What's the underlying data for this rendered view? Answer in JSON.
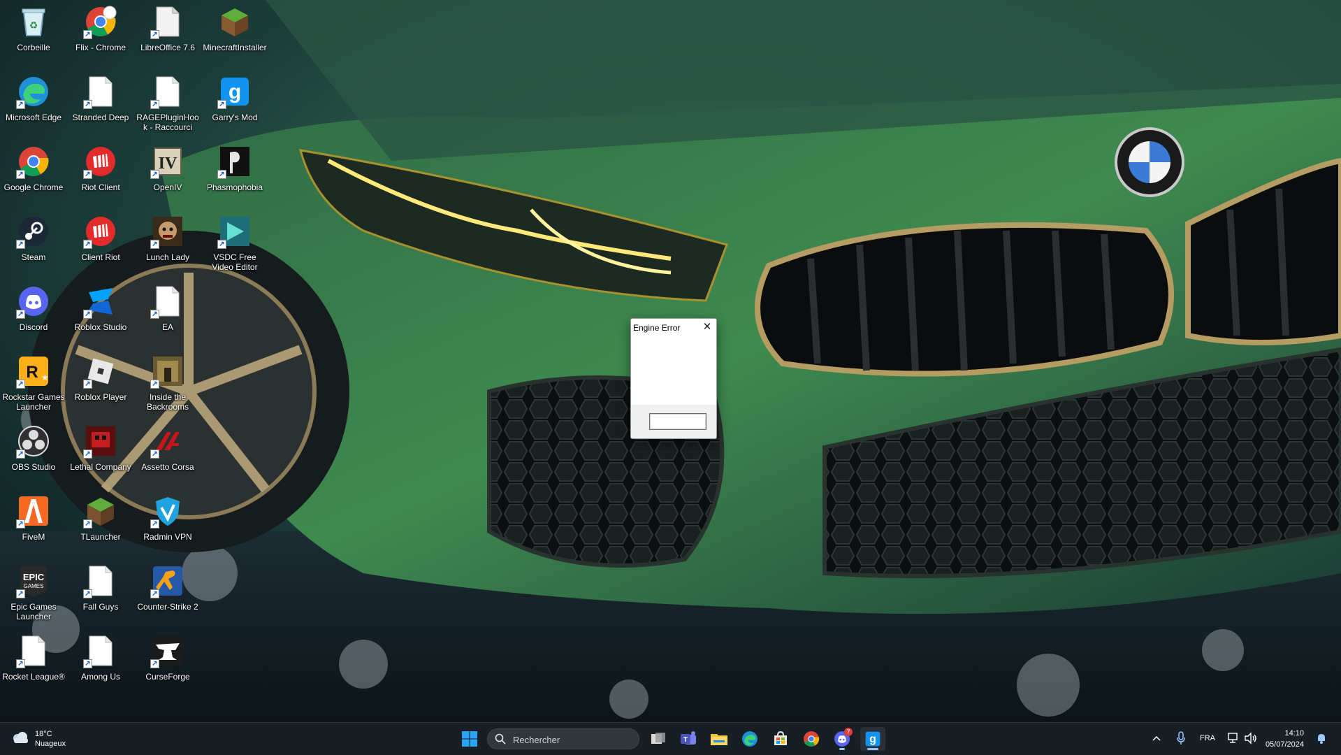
{
  "desktop": {
    "icons": [
      {
        "label": "Corbeille",
        "icon": "recycle-bin-icon"
      },
      {
        "label": "Flix - Chrome",
        "icon": "chrome-icon"
      },
      {
        "label": "LibreOffice 7.6",
        "icon": "file-icon"
      },
      {
        "label": "MinecraftInstaller",
        "icon": "minecraft-icon"
      },
      {
        "label": "Microsoft Edge",
        "icon": "edge-icon"
      },
      {
        "label": "Stranded Deep",
        "icon": "file-icon"
      },
      {
        "label": "RAGEPluginHook - Raccourci",
        "icon": "file-icon"
      },
      {
        "label": "Garry's Mod",
        "icon": "garrys-mod-icon"
      },
      {
        "label": "Google Chrome",
        "icon": "chrome-icon"
      },
      {
        "label": "Riot Client",
        "icon": "riot-icon"
      },
      {
        "label": "OpenIV",
        "icon": "openiv-icon"
      },
      {
        "label": "Phasmophobia",
        "icon": "phasmophobia-icon"
      },
      {
        "label": "Steam",
        "icon": "steam-icon"
      },
      {
        "label": "Client Riot",
        "icon": "riot-icon"
      },
      {
        "label": "Lunch Lady",
        "icon": "lunch-lady-icon"
      },
      {
        "label": "VSDC Free Video Editor",
        "icon": "vsdc-icon"
      },
      {
        "label": "Discord",
        "icon": "discord-icon"
      },
      {
        "label": "Roblox Studio",
        "icon": "roblox-studio-icon"
      },
      {
        "label": "EA",
        "icon": "file-icon"
      },
      {
        "label": "Rockstar Games Launcher",
        "icon": "rockstar-icon"
      },
      {
        "label": "Roblox Player",
        "icon": "roblox-icon"
      },
      {
        "label": "Inside the Backrooms",
        "icon": "backrooms-icon"
      },
      {
        "label": "OBS Studio",
        "icon": "obs-icon"
      },
      {
        "label": "Lethal Company",
        "icon": "lethal-company-icon"
      },
      {
        "label": "Assetto Corsa",
        "icon": "assetto-corsa-icon"
      },
      {
        "label": "FiveM",
        "icon": "fivem-icon"
      },
      {
        "label": "TLauncher",
        "icon": "tlauncher-icon"
      },
      {
        "label": "Radmin VPN",
        "icon": "radmin-vpn-icon"
      },
      {
        "label": "Epic Games Launcher",
        "icon": "epic-games-icon"
      },
      {
        "label": "Fall Guys",
        "icon": "file-icon"
      },
      {
        "label": "Counter-Strike 2",
        "icon": "counter-strike-icon"
      },
      {
        "label": "Rocket League®",
        "icon": "file-icon"
      },
      {
        "label": "Among Us",
        "icon": "file-icon"
      },
      {
        "label": "CurseForge",
        "icon": "curseforge-icon"
      }
    ]
  },
  "dialog": {
    "title": "Engine Error",
    "close_icon": "close-icon",
    "ok_label": ""
  },
  "taskbar": {
    "weather": {
      "temperature": "18°C",
      "condition": "Nuageux",
      "icon": "cloud-icon"
    },
    "search": {
      "placeholder": "Rechercher",
      "icon": "search-icon"
    },
    "pinned": [
      "start-icon",
      "task-view-icon",
      "teams-icon",
      "file-explorer-icon",
      "edge-icon",
      "store-icon",
      "chrome-icon",
      "discord-icon",
      "garrys-mod-icon"
    ],
    "discord_badge": "7",
    "tray": {
      "language": "FRA",
      "time": "14:10",
      "date": "05/07/2024"
    }
  },
  "colors": {
    "taskbar_bg": "#181e24",
    "accent": "#4cc2ff",
    "wallpaper_car": "#1f4a32"
  }
}
